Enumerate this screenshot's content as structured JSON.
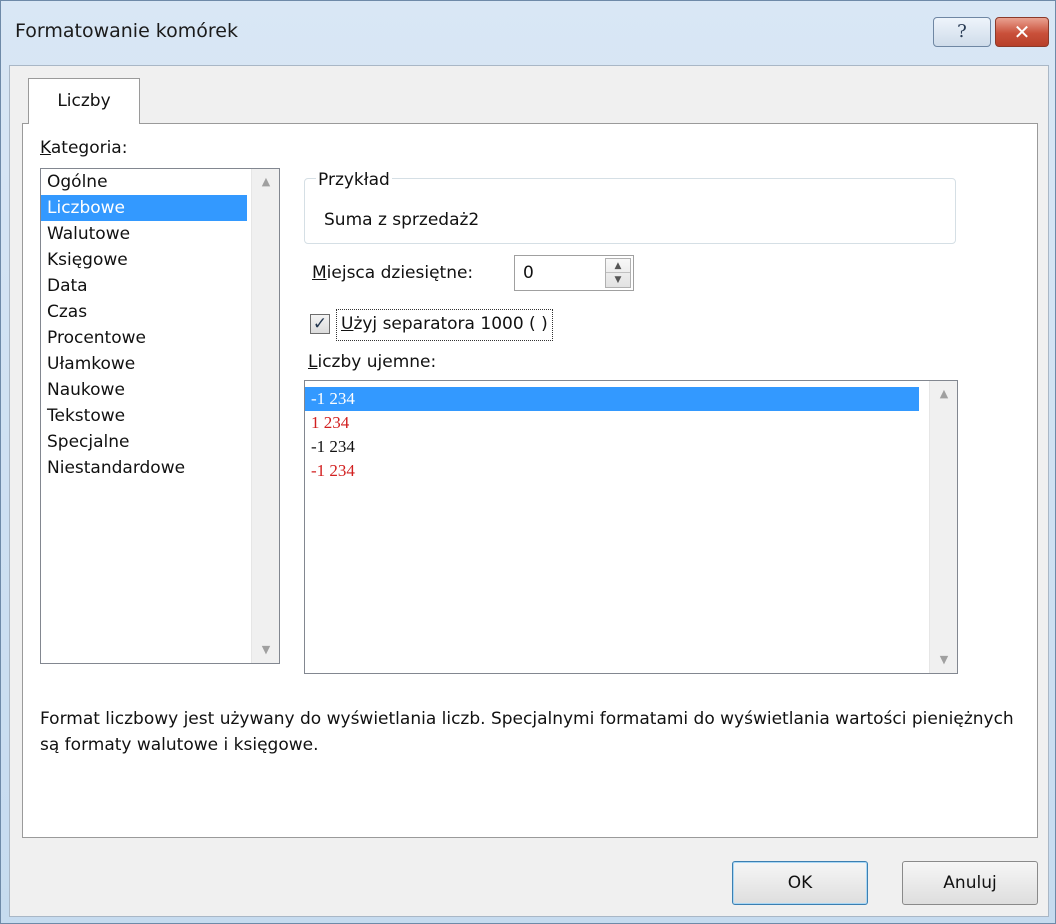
{
  "window": {
    "title": "Formatowanie komórek",
    "help_label": "?",
    "close_label": "✕"
  },
  "tabs": [
    {
      "label": "Liczby",
      "active": true
    }
  ],
  "category": {
    "label_first": "K",
    "label_rest": "ategoria:",
    "items": [
      "Ogólne",
      "Liczbowe",
      "Walutowe",
      "Księgowe",
      "Data",
      "Czas",
      "Procentowe",
      "Ułamkowe",
      "Naukowe",
      "Tekstowe",
      "Specjalne",
      "Niestandardowe"
    ],
    "selected": "Liczbowe"
  },
  "sample": {
    "legend": "Przykład",
    "value": "Suma z sprzedaż2"
  },
  "decimals": {
    "label_first": "M",
    "label_rest": "iejsca dziesiętne:",
    "value": "0"
  },
  "separator": {
    "checked": true,
    "check_glyph": "✓",
    "label_first": "U",
    "label_rest": "żyj separatora 1000 ( )"
  },
  "negative": {
    "label_first": "L",
    "label_rest": "iczby ujemne:",
    "items": [
      {
        "text": "-1 234",
        "color": "#ffffff",
        "selected": true
      },
      {
        "text": "1 234",
        "color": "#d22020",
        "selected": false
      },
      {
        "text": "-1 234",
        "color": "#111111",
        "selected": false
      },
      {
        "text": "-1 234",
        "color": "#d22020",
        "selected": false
      }
    ]
  },
  "description": "Format liczbowy jest używany do wyświetlania liczb. Specjalnymi formatami do wyświetlania wartości pieniężnych są formaty walutowe i księgowe.",
  "buttons": {
    "ok": "OK",
    "cancel": "Anuluj"
  },
  "icons": {
    "scroll_up": "▲",
    "scroll_down": "▼"
  }
}
